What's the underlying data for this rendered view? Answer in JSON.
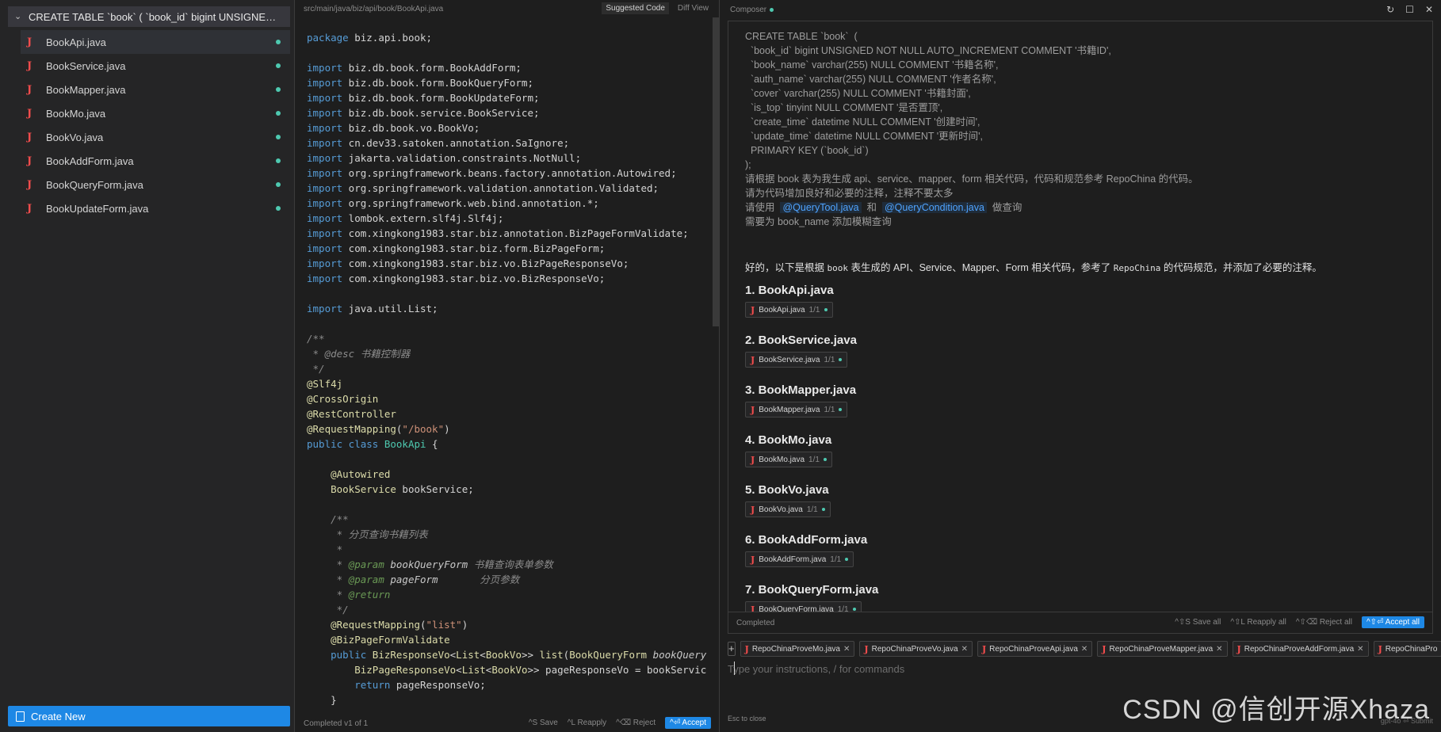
{
  "sidebar": {
    "group_title": "CREATE TABLE `book` ( `book_id` bigint UNSIGNED ...",
    "files": [
      {
        "name": "BookApi.java"
      },
      {
        "name": "BookService.java"
      },
      {
        "name": "BookMapper.java"
      },
      {
        "name": "BookMo.java"
      },
      {
        "name": "BookVo.java"
      },
      {
        "name": "BookAddForm.java"
      },
      {
        "name": "BookQueryForm.java"
      },
      {
        "name": "BookUpdateForm.java"
      }
    ],
    "create_new": "Create New"
  },
  "editor": {
    "path": "src/main/java/biz/api/book/BookApi.java",
    "tab_suggested": "Suggested Code",
    "tab_diff": "Diff View",
    "status": "Completed v1 of 1",
    "actions": {
      "save": "^S Save",
      "reapply": "^L Reapply",
      "reject": "^⌫ Reject",
      "accept": "^⏎ Accept"
    }
  },
  "composer": {
    "title": "Composer",
    "user_message": "CREATE TABLE `book`  (\n  `book_id` bigint UNSIGNED NOT NULL AUTO_INCREMENT COMMENT '书籍ID',\n  `book_name` varchar(255) NULL COMMENT '书籍名称',\n  `auth_name` varchar(255) NULL COMMENT '作者名称',\n  `cover` varchar(255) NULL COMMENT '书籍封面',\n  `is_top` tinyint NULL COMMENT '是否置顶',\n  `create_time` datetime NULL COMMENT '创建时间',\n  `update_time` datetime NULL COMMENT '更新时间',\n  PRIMARY KEY (`book_id`)\n);\n请根据 book 表为我生成 api、service、mapper、form 相关代码，代码和规范参考 RepoChina 的代码。\n请为代码增加良好和必要的注释，注释不要太多",
    "use_prefix": "请使用",
    "mention1": "@QueryTool.java",
    "and": "和",
    "mention2": "@QueryCondition.java",
    "do_query": "做查询",
    "fuzzy": "需要为 book_name 添加模糊查询",
    "ai_reply": {
      "p1": "好的，以下是根据 ",
      "code1": "book",
      "p2": " 表生成的 API、Service、Mapper、Form 相关代码，参考了 ",
      "code2": "RepoChina",
      "p3": " 的代码规范，并添加了必要的注释。"
    },
    "sections": [
      {
        "heading": "1. BookApi.java",
        "chip": "BookApi.java",
        "count": "1/1"
      },
      {
        "heading": "2. BookService.java",
        "chip": "BookService.java",
        "count": "1/1"
      },
      {
        "heading": "3. BookMapper.java",
        "chip": "BookMapper.java",
        "count": "1/1"
      },
      {
        "heading": "4. BookMo.java",
        "chip": "BookMo.java",
        "count": "1/1"
      },
      {
        "heading": "5. BookVo.java",
        "chip": "BookVo.java",
        "count": "1/1"
      },
      {
        "heading": "6. BookAddForm.java",
        "chip": "BookAddForm.java",
        "count": "1/1"
      },
      {
        "heading": "7. BookQueryForm.java",
        "chip": "BookQueryForm.java",
        "count": "1/1"
      }
    ],
    "status": "Completed",
    "actions": {
      "save_all": "^⇧S Save all",
      "reapply_all": "^⇧L Reapply all",
      "reject_all": "^⇧⌫ Reject all",
      "accept_all": "^⇧⏎ Accept all"
    },
    "context_files": [
      "RepoChinaProveMo.java",
      "RepoChinaProveVo.java",
      "RepoChinaProveApi.java",
      "RepoChinaProveMapper.java",
      "RepoChinaProveAddForm.java",
      "RepoChinaPro"
    ],
    "input_placeholder": "Type your instructions, / for commands",
    "esc_hint": "Esc to close",
    "model_hint": "gpt-4o  ⏎ Submit",
    "watermark": "CSDN @信创开源Xhaza"
  }
}
